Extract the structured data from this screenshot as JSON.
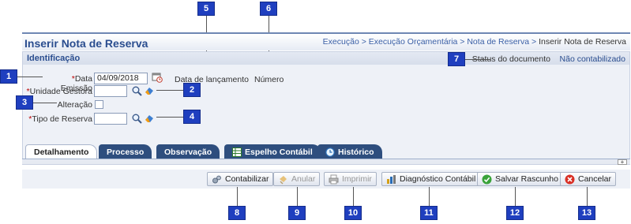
{
  "header": {
    "title": "Inserir Nota de Reserva",
    "breadcrumb": {
      "path": "Execução > Execução Orçamentária > Nota de Reserva > ",
      "current": "Inserir Nota de Reserva"
    }
  },
  "identificacao": {
    "title": "Identificação",
    "status_label": "Status do documento",
    "status_value": "Não contabilizado",
    "data_emissao": {
      "label": "Data Emissão",
      "value": "04/09/2018"
    },
    "data_lancamento_label": "Data de lançamento",
    "numero_label": "Número",
    "unidade_gestora": {
      "label": "Unidade Gestora",
      "value": ""
    },
    "alteracao": {
      "label": "Alteração",
      "checked": false
    },
    "tipo_reserva": {
      "label": "Tipo de Reserva",
      "value": ""
    },
    "required_mark": "*"
  },
  "tabs": [
    {
      "label": "Detalhamento",
      "active": true
    },
    {
      "label": "Processo",
      "active": false
    },
    {
      "label": "Observação",
      "active": false
    },
    {
      "label": "Espelho Contábil",
      "active": false,
      "icon": "ledger-icon"
    },
    {
      "label": "Histórico",
      "active": false,
      "icon": "history-icon"
    }
  ],
  "expand_symbol": "+",
  "toolbar": {
    "contabilizar": "Contabilizar",
    "anular": "Anular",
    "imprimir": "Imprimir",
    "diagnostico": "Diagnóstico Contábil",
    "salvar": "Salvar Rascunho",
    "cancelar": "Cancelar"
  },
  "markers": [
    "1",
    "2",
    "3",
    "4",
    "5",
    "6",
    "7",
    "8",
    "9",
    "10",
    "11",
    "12",
    "13"
  ],
  "colors": {
    "marker": "#1f3fbf",
    "title": "#2a4d8f",
    "tab": "#2e4e7e",
    "link": "#3a5fa6"
  }
}
